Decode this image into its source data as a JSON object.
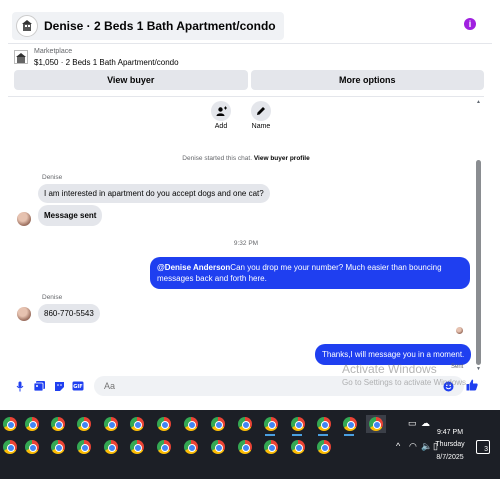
{
  "header": {
    "title": "Denise · 2 Beds 1 Bath Apartment/condo",
    "info_icon": "info-icon",
    "accent": "#a020e0"
  },
  "listing": {
    "kicker": "Marketplace",
    "line": "$1,050 · 2 Beds 1 Bath Apartment/condo"
  },
  "actions": {
    "view_buyer": "View buyer",
    "more_options": "More options"
  },
  "quick_actions": [
    {
      "label": "Add",
      "icon": "add-person-icon"
    },
    {
      "label": "Name",
      "icon": "pencil-icon"
    }
  ],
  "chat": {
    "started_prefix": "Denise started this chat.",
    "started_link": "View buyer profile",
    "timestamp": "9:32 PM",
    "messages": [
      {
        "sender": "Denise",
        "text": "I am interested in apartment do you accept dogs and one cat?"
      },
      {
        "text": "Message sent"
      },
      {
        "mention": "@Denise Anderson",
        "text": "Can you drop me your number? Much easier than bouncing messages back and forth here."
      },
      {
        "sender": "Denise",
        "text": "860-770-5543"
      },
      {
        "text": "Thanks,I will message you in a moment."
      }
    ],
    "sent_status": "Sent",
    "outgoing_color": "#1f3ff0"
  },
  "composer": {
    "placeholder": "Aa",
    "icons": [
      "microphone-icon",
      "photo-icon",
      "sticker-icon",
      "gif-icon",
      "emoji-icon",
      "thumbs-up-icon"
    ]
  },
  "watermark": {
    "line1": "Activate Windows",
    "line2": "Go to Settings to activate Windows."
  },
  "taskbar": {
    "time": "9:47 PM",
    "day": "Thursday",
    "date": "8/7/2025",
    "notification_count": "3"
  }
}
